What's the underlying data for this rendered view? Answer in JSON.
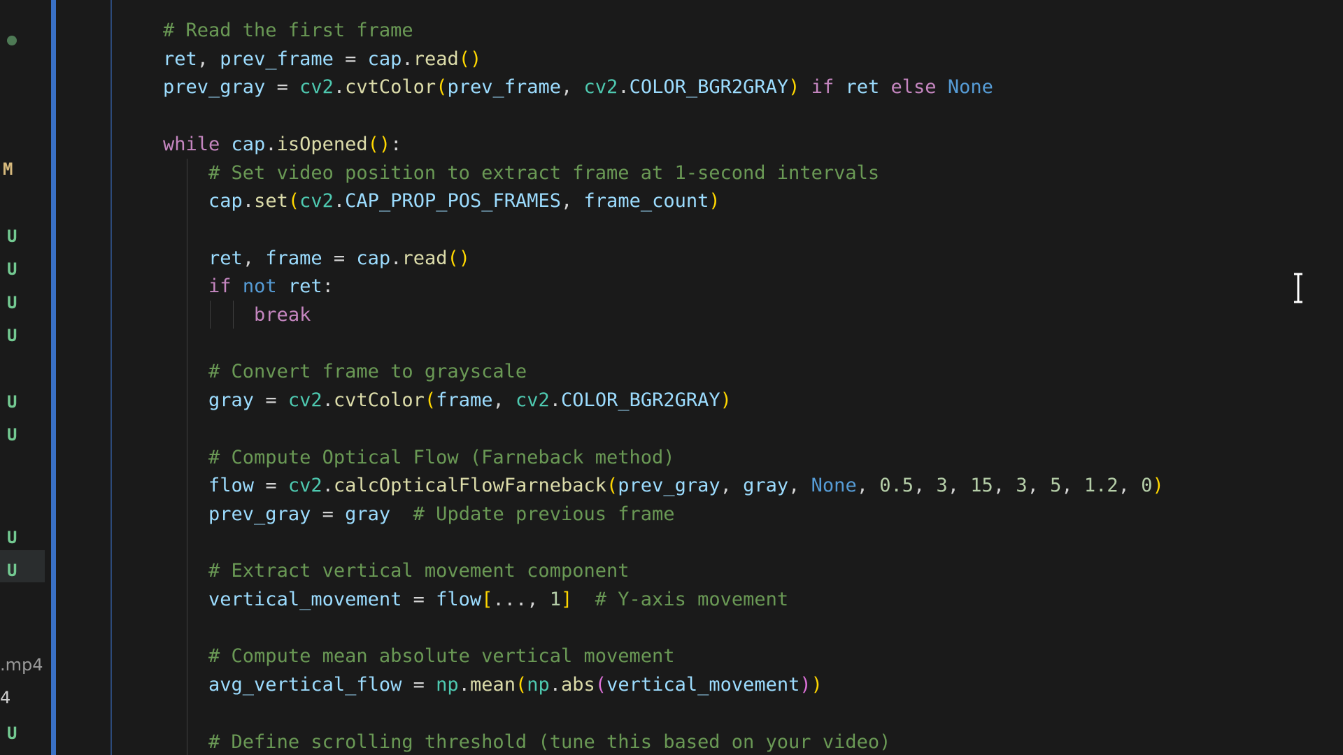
{
  "explorer": {
    "status_badges": [
      {
        "type": "dot"
      },
      {
        "label": "M"
      },
      {
        "label": "U"
      },
      {
        "label": "U"
      },
      {
        "label": "U"
      },
      {
        "label": "U"
      },
      {
        "label": "U"
      },
      {
        "label": "U"
      },
      {
        "label": "U"
      },
      {
        "label": "U"
      },
      {
        "label": "U"
      }
    ],
    "partial_filename": ".mp4",
    "partial_filename_2": "4"
  },
  "code": {
    "lines": [
      [
        [
          "# Read the first frame",
          "cm"
        ]
      ],
      [
        [
          "ret",
          "var"
        ],
        [
          ", ",
          "plain"
        ],
        [
          "prev_frame",
          "var"
        ],
        [
          " = ",
          "plain"
        ],
        [
          "cap",
          "var"
        ],
        [
          ".",
          "plain"
        ],
        [
          "read",
          "fn"
        ],
        [
          "()",
          "p1"
        ]
      ],
      [
        [
          "prev_gray",
          "var"
        ],
        [
          " = ",
          "plain"
        ],
        [
          "cv2",
          "mod"
        ],
        [
          ".",
          "plain"
        ],
        [
          "cvtColor",
          "fn"
        ],
        [
          "(",
          "p1"
        ],
        [
          "prev_frame",
          "var"
        ],
        [
          ", ",
          "plain"
        ],
        [
          "cv2",
          "mod"
        ],
        [
          ".",
          "plain"
        ],
        [
          "COLOR_BGR2GRAY",
          "var"
        ],
        [
          ")",
          "p1"
        ],
        [
          " ",
          "plain"
        ],
        [
          "if",
          "kw"
        ],
        [
          " ",
          "plain"
        ],
        [
          "ret",
          "var"
        ],
        [
          " ",
          "plain"
        ],
        [
          "else",
          "kw"
        ],
        [
          " ",
          "plain"
        ],
        [
          "None",
          "none"
        ]
      ],
      [],
      [
        [
          "while",
          "kw"
        ],
        [
          " ",
          "plain"
        ],
        [
          "cap",
          "var"
        ],
        [
          ".",
          "plain"
        ],
        [
          "isOpened",
          "fn"
        ],
        [
          "()",
          "p1"
        ],
        [
          ":",
          "plain"
        ]
      ],
      [
        [
          "    ",
          "plain"
        ],
        [
          "# Set video position to extract frame at 1-second intervals",
          "cm"
        ]
      ],
      [
        [
          "    ",
          "plain"
        ],
        [
          "cap",
          "var"
        ],
        [
          ".",
          "plain"
        ],
        [
          "set",
          "fn"
        ],
        [
          "(",
          "p1"
        ],
        [
          "cv2",
          "mod"
        ],
        [
          ".",
          "plain"
        ],
        [
          "CAP_PROP_POS_FRAMES",
          "var"
        ],
        [
          ", ",
          "plain"
        ],
        [
          "frame_count",
          "var"
        ],
        [
          ")",
          "p1"
        ]
      ],
      [],
      [
        [
          "    ",
          "plain"
        ],
        [
          "ret",
          "var"
        ],
        [
          ", ",
          "plain"
        ],
        [
          "frame",
          "var"
        ],
        [
          " = ",
          "plain"
        ],
        [
          "cap",
          "var"
        ],
        [
          ".",
          "plain"
        ],
        [
          "read",
          "fn"
        ],
        [
          "()",
          "p1"
        ]
      ],
      [
        [
          "    ",
          "plain"
        ],
        [
          "if",
          "kw"
        ],
        [
          " ",
          "plain"
        ],
        [
          "not",
          "none"
        ],
        [
          " ",
          "plain"
        ],
        [
          "ret",
          "var"
        ],
        [
          ":",
          "plain"
        ]
      ],
      [
        [
          "        ",
          "plain"
        ],
        [
          "break",
          "kw"
        ]
      ],
      [],
      [
        [
          "    ",
          "plain"
        ],
        [
          "# Convert frame to grayscale",
          "cm"
        ]
      ],
      [
        [
          "    ",
          "plain"
        ],
        [
          "gray",
          "var"
        ],
        [
          " = ",
          "plain"
        ],
        [
          "cv2",
          "mod"
        ],
        [
          ".",
          "plain"
        ],
        [
          "cvtColor",
          "fn"
        ],
        [
          "(",
          "p1"
        ],
        [
          "frame",
          "var"
        ],
        [
          ", ",
          "plain"
        ],
        [
          "cv2",
          "mod"
        ],
        [
          ".",
          "plain"
        ],
        [
          "COLOR_BGR2GRAY",
          "var"
        ],
        [
          ")",
          "p1"
        ]
      ],
      [],
      [
        [
          "    ",
          "plain"
        ],
        [
          "# Compute Optical Flow (Farneback method)",
          "cm"
        ]
      ],
      [
        [
          "    ",
          "plain"
        ],
        [
          "flow",
          "var"
        ],
        [
          " = ",
          "plain"
        ],
        [
          "cv2",
          "mod"
        ],
        [
          ".",
          "plain"
        ],
        [
          "calcOpticalFlowFarneback",
          "fn"
        ],
        [
          "(",
          "p1"
        ],
        [
          "prev_gray",
          "var"
        ],
        [
          ", ",
          "plain"
        ],
        [
          "gray",
          "var"
        ],
        [
          ", ",
          "plain"
        ],
        [
          "None",
          "none"
        ],
        [
          ", ",
          "plain"
        ],
        [
          "0.5",
          "num"
        ],
        [
          ", ",
          "plain"
        ],
        [
          "3",
          "num"
        ],
        [
          ", ",
          "plain"
        ],
        [
          "15",
          "num"
        ],
        [
          ", ",
          "plain"
        ],
        [
          "3",
          "num"
        ],
        [
          ", ",
          "plain"
        ],
        [
          "5",
          "num"
        ],
        [
          ", ",
          "plain"
        ],
        [
          "1.2",
          "num"
        ],
        [
          ", ",
          "plain"
        ],
        [
          "0",
          "num"
        ],
        [
          ")",
          "p1"
        ]
      ],
      [
        [
          "    ",
          "plain"
        ],
        [
          "prev_gray",
          "var"
        ],
        [
          " = ",
          "plain"
        ],
        [
          "gray",
          "var"
        ],
        [
          "  ",
          "plain"
        ],
        [
          "# Update previous frame",
          "cm"
        ]
      ],
      [],
      [
        [
          "    ",
          "plain"
        ],
        [
          "# Extract vertical movement component",
          "cm"
        ]
      ],
      [
        [
          "    ",
          "plain"
        ],
        [
          "vertical_movement",
          "var"
        ],
        [
          " = ",
          "plain"
        ],
        [
          "flow",
          "var"
        ],
        [
          "[",
          "p1"
        ],
        [
          "..., ",
          "plain"
        ],
        [
          "1",
          "num"
        ],
        [
          "]",
          "p1"
        ],
        [
          "  ",
          "plain"
        ],
        [
          "# Y-axis movement",
          "cm"
        ]
      ],
      [],
      [
        [
          "    ",
          "plain"
        ],
        [
          "# Compute mean absolute vertical movement",
          "cm"
        ]
      ],
      [
        [
          "    ",
          "plain"
        ],
        [
          "avg_vertical_flow",
          "var"
        ],
        [
          " = ",
          "plain"
        ],
        [
          "np",
          "mod"
        ],
        [
          ".",
          "plain"
        ],
        [
          "mean",
          "fn"
        ],
        [
          "(",
          "p1"
        ],
        [
          "np",
          "mod"
        ],
        [
          ".",
          "plain"
        ],
        [
          "abs",
          "fn"
        ],
        [
          "(",
          "p2"
        ],
        [
          "vertical_movement",
          "var"
        ],
        [
          ")",
          "p2"
        ],
        [
          ")",
          "p1"
        ]
      ],
      [],
      [
        [
          "    ",
          "plain"
        ],
        [
          "# Define scrolling threshold (tune this based on your video)",
          "cm"
        ]
      ]
    ]
  }
}
